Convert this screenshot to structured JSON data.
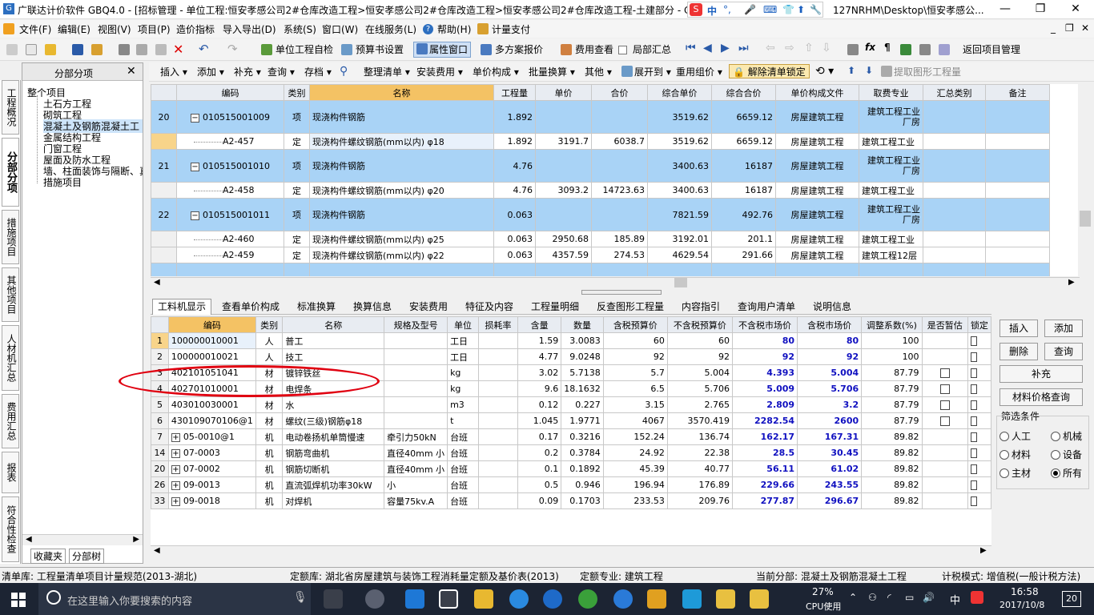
{
  "window": {
    "title": "广联达计价软件 GBQ4.0 - [招标管理 - 单位工程:恒安孝感公司2#仓库改造工程>恒安孝感公司2#仓库改造工程>恒安孝感公司2#仓库改造工程-土建部分 - C:",
    "title_tail": "127NRHM\\Desktop\\恒安孝感公...",
    "app_icon": "app-icon",
    "minimize": "—",
    "restore": "❐",
    "close": "✕"
  },
  "ime": {
    "items": [
      "中",
      "°,",
      "🎤",
      "⌨",
      "👕",
      "⬆",
      "🔧"
    ]
  },
  "menubar": [
    "文件(F)",
    "编辑(E)",
    "视图(V)",
    "项目(P)",
    "造价指标",
    "导入导出(D)",
    "系统(S)",
    "窗口(W)",
    "在线服务(L)",
    "帮助(H)",
    "计量支付"
  ],
  "mdi_controls": [
    "_",
    "❐",
    "✕"
  ],
  "toolbar1": {
    "buttons": [
      "单位工程自检",
      "预算书设置",
      "属性窗口",
      "多方案报价",
      "费用查看",
      "局部汇总",
      "返回项目管理"
    ]
  },
  "left_tabs": [
    "工程概况",
    "分部分项",
    "措施项目",
    "其他项目",
    "人材机汇总",
    "费用汇总",
    "报表",
    "符合性检查"
  ],
  "nav": {
    "header": "分部分项",
    "close": "✕",
    "root": "整个项目",
    "items": [
      "土石方工程",
      "砌筑工程",
      "混凝土及钢筋混凝土工",
      "金属结构工程",
      "门窗工程",
      "屋面及防水工程",
      "墙、柱面装饰与隔断、真",
      "措施项目"
    ],
    "bottom_tabs": [
      "收藏夹",
      "分部树"
    ]
  },
  "toolbar2": {
    "buttons": [
      "插入",
      "添加",
      "补充",
      "查询",
      "存档",
      "整理清单",
      "安装费用",
      "单价构成",
      "批量换算",
      "其他",
      "展开到",
      "重用组价",
      "解除清单锁定",
      "提取图形工程量"
    ]
  },
  "grid1": {
    "columns": [
      "编码",
      "类别",
      "名称",
      "工程量",
      "单价",
      "合价",
      "综合单价",
      "综合合价",
      "单价构成文件",
      "取费专业",
      "汇总类别",
      "备注"
    ],
    "rows": [
      {
        "seq": "20",
        "code": "010515001009",
        "type": "项",
        "name": "现浇构件钢筋",
        "qty": "1.892",
        "price": "",
        "total": "",
        "uprice": "3519.62",
        "utotal": "6659.12",
        "file": "房屋建筑工程",
        "spec": "建筑工程工业厂房",
        "kind": "item"
      },
      {
        "seq": "",
        "code": "A2-457",
        "type": "定",
        "name": "现浇构件螺纹钢筋(mm以内) φ18",
        "qty": "1.892",
        "price": "3191.7",
        "total": "6038.7",
        "uprice": "3519.62",
        "utotal": "6659.12",
        "file": "房屋建筑工程",
        "spec": "建筑工程工业",
        "kind": "sub"
      },
      {
        "seq": "21",
        "code": "010515001010",
        "type": "项",
        "name": "现浇构件钢筋",
        "qty": "4.76",
        "price": "",
        "total": "",
        "uprice": "3400.63",
        "utotal": "16187",
        "file": "房屋建筑工程",
        "spec": "建筑工程工业厂房",
        "kind": "item"
      },
      {
        "seq": "",
        "code": "A2-458",
        "type": "定",
        "name": "现浇构件螺纹钢筋(mm以内) φ20",
        "qty": "4.76",
        "price": "3093.2",
        "total": "14723.63",
        "uprice": "3400.63",
        "utotal": "16187",
        "file": "房屋建筑工程",
        "spec": "建筑工程工业",
        "kind": "sub"
      },
      {
        "seq": "22",
        "code": "010515001011",
        "type": "项",
        "name": "现浇构件钢筋",
        "qty": "0.063",
        "price": "",
        "total": "",
        "uprice": "7821.59",
        "utotal": "492.76",
        "file": "房屋建筑工程",
        "spec": "建筑工程工业厂房",
        "kind": "item"
      },
      {
        "seq": "",
        "code": "A2-460",
        "type": "定",
        "name": "现浇构件螺纹钢筋(mm以内) φ25",
        "qty": "0.063",
        "price": "2950.68",
        "total": "185.89",
        "uprice": "3192.01",
        "utotal": "201.1",
        "file": "房屋建筑工程",
        "spec": "建筑工程工业",
        "kind": "sub"
      },
      {
        "seq": "",
        "code": "A2-459",
        "type": "定",
        "name": "现浇构件螺纹钢筋(mm以内) φ22",
        "qty": "0.063",
        "price": "4357.59",
        "total": "274.53",
        "uprice": "4629.54",
        "utotal": "291.66",
        "file": "房屋建筑工程",
        "spec": "建筑工程12层",
        "kind": "sub"
      }
    ]
  },
  "tabs2": [
    "工料机显示",
    "查看单价构成",
    "标准换算",
    "换算信息",
    "安装费用",
    "特征及内容",
    "工程量明细",
    "反查图形工程量",
    "内容指引",
    "查询用户清单",
    "说明信息"
  ],
  "grid2": {
    "columns": [
      "编码",
      "类别",
      "名称",
      "规格及型号",
      "单位",
      "损耗率",
      "含量",
      "数量",
      "含税预算价",
      "不含税预算价",
      "不含税市场价",
      "含税市场价",
      "调整系数(%)",
      "是否暂估",
      "锁定"
    ],
    "rows": [
      {
        "n": "1",
        "exp": "",
        "code": "100000010001",
        "type": "人",
        "name": "普工",
        "spec": "",
        "unit": "工日",
        "loss": "",
        "content": "1.59",
        "qty": "3.0083",
        "p1": "60",
        "p2": "60",
        "p3": "80",
        "p4": "80",
        "adj": "100",
        "est": false
      },
      {
        "n": "2",
        "exp": "",
        "code": "100000010021",
        "type": "人",
        "name": "技工",
        "spec": "",
        "unit": "工日",
        "loss": "",
        "content": "4.77",
        "qty": "9.0248",
        "p1": "92",
        "p2": "92",
        "p3": "92",
        "p4": "92",
        "adj": "100",
        "est": false
      },
      {
        "n": "3",
        "exp": "",
        "code": "402101051041",
        "type": "材",
        "name": "镀锌铁丝",
        "spec": "",
        "unit": "kg",
        "loss": "",
        "content": "3.02",
        "qty": "5.7138",
        "p1": "5.7",
        "p2": "5.004",
        "p3": "4.393",
        "p4": "5.004",
        "adj": "87.79",
        "est": true
      },
      {
        "n": "4",
        "exp": "",
        "code": "402701010001",
        "type": "材",
        "name": "电焊条",
        "spec": "",
        "unit": "kg",
        "loss": "",
        "content": "9.6",
        "qty": "18.1632",
        "p1": "6.5",
        "p2": "5.706",
        "p3": "5.009",
        "p4": "5.706",
        "adj": "87.79",
        "est": true
      },
      {
        "n": "5",
        "exp": "",
        "code": "403010030001",
        "type": "材",
        "name": "水",
        "spec": "",
        "unit": "m3",
        "loss": "",
        "content": "0.12",
        "qty": "0.227",
        "p1": "3.15",
        "p2": "2.765",
        "p3": "2.809",
        "p4": "3.2",
        "adj": "87.79",
        "est": true
      },
      {
        "n": "6",
        "exp": "",
        "code": "430109070106@1",
        "type": "材",
        "name": "螺纹(三级)钢筋φ18",
        "spec": "",
        "unit": "t",
        "loss": "",
        "content": "1.045",
        "qty": "1.9771",
        "p1": "4067",
        "p2": "3570.419",
        "p3": "2282.54",
        "p4": "2600",
        "adj": "87.79",
        "est": true
      },
      {
        "n": "7",
        "exp": "+",
        "code": "05-0010@1",
        "type": "机",
        "name": "电动卷扬机单筒慢速",
        "spec": "牵引力50kN",
        "unit": "台班",
        "loss": "",
        "content": "0.17",
        "qty": "0.3216",
        "p1": "152.24",
        "p2": "136.74",
        "p3": "162.17",
        "p4": "167.31",
        "adj": "89.82",
        "est": false
      },
      {
        "n": "14",
        "exp": "+",
        "code": "07-0003",
        "type": "机",
        "name": "钢筋弯曲机",
        "spec": "直径40mm 小",
        "unit": "台班",
        "loss": "",
        "content": "0.2",
        "qty": "0.3784",
        "p1": "24.92",
        "p2": "22.38",
        "p3": "28.5",
        "p4": "30.45",
        "adj": "89.82",
        "est": false
      },
      {
        "n": "20",
        "exp": "+",
        "code": "07-0002",
        "type": "机",
        "name": "钢筋切断机",
        "spec": "直径40mm 小",
        "unit": "台班",
        "loss": "",
        "content": "0.1",
        "qty": "0.1892",
        "p1": "45.39",
        "p2": "40.77",
        "p3": "56.11",
        "p4": "61.02",
        "adj": "89.82",
        "est": false
      },
      {
        "n": "26",
        "exp": "+",
        "code": "09-0013",
        "type": "机",
        "name": "直流弧焊机功率30kW",
        "spec": "小",
        "unit": "台班",
        "loss": "",
        "content": "0.5",
        "qty": "0.946",
        "p1": "196.94",
        "p2": "176.89",
        "p3": "229.66",
        "p4": "243.55",
        "adj": "89.82",
        "est": false
      },
      {
        "n": "33",
        "exp": "+",
        "code": "09-0018",
        "type": "机",
        "name": "对焊机",
        "spec": "容量75kv.A",
        "unit": "台班",
        "loss": "",
        "content": "0.09",
        "qty": "0.1703",
        "p1": "233.53",
        "p2": "209.76",
        "p3": "277.87",
        "p4": "296.67",
        "adj": "89.82",
        "est": false
      }
    ]
  },
  "side_buttons": {
    "insert": "插入",
    "add": "添加",
    "delete": "删除",
    "query": "查询",
    "supplement": "补充",
    "price_query": "材料价格查询",
    "filter_title": "筛选条件",
    "filters": [
      "人工",
      "机械",
      "材料",
      "设备",
      "主材",
      "所有"
    ],
    "filter_selected": "所有"
  },
  "statusbar": {
    "list_lib": "清单库: 工程量清单项目计量规范(2013-湖北)",
    "quota_lib": "定额库: 湖北省房屋建筑与装饰工程消耗量定额及基价表(2013)",
    "quota_spec": "定额专业: 建筑工程",
    "current": "当前分部: 混凝土及钢筋混凝土工程",
    "tax_mode": "计税模式: 增值税(一般计税方法)"
  },
  "taskbar": {
    "search_placeholder": "在这里输入你要搜索的内容",
    "cpu_pct": "27%",
    "cpu_label": "CPU使用",
    "ime": "中",
    "time": "16:58",
    "date": "2017/10/8",
    "notif": "20"
  }
}
